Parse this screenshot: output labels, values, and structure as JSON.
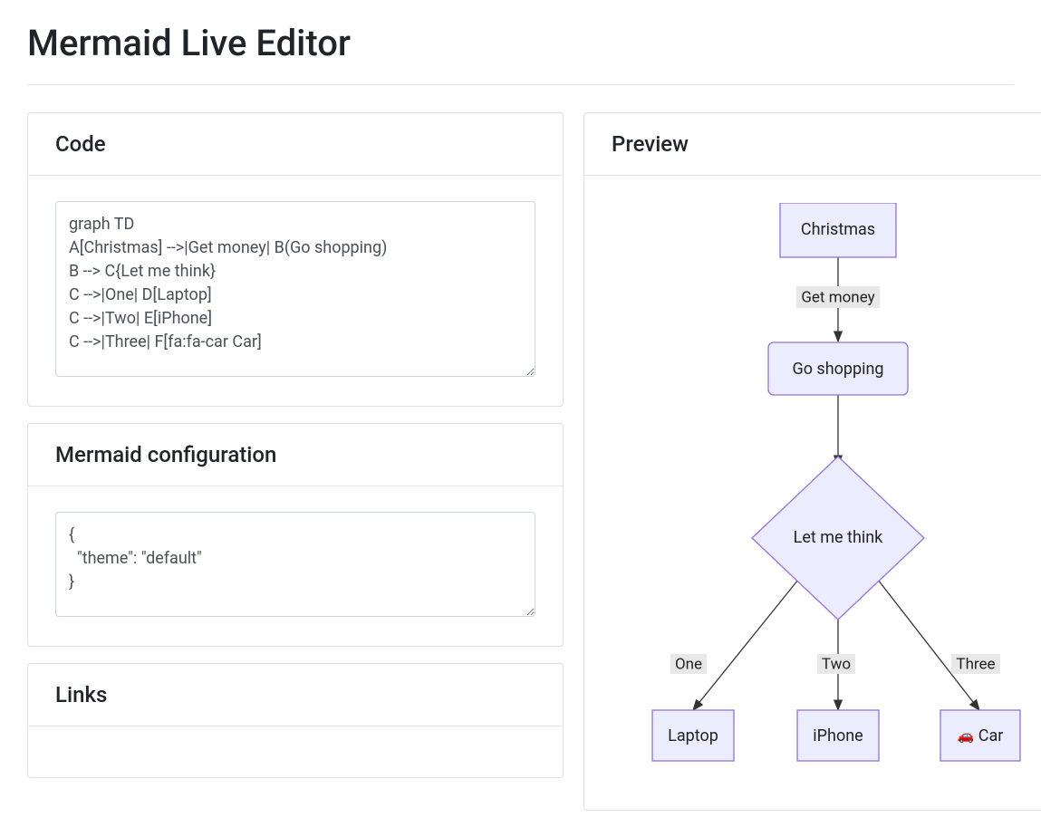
{
  "page_title": "Mermaid Live Editor",
  "panels": {
    "code": {
      "heading": "Code",
      "value": "graph TD\nA[Christmas] -->|Get money| B(Go shopping)\nB --> C{Let me think}\nC -->|One| D[Laptop]\nC -->|Two| E[iPhone]\nC -->|Three| F[fa:fa-car Car]"
    },
    "config": {
      "heading": "Mermaid configuration",
      "value": "{\n  \"theme\": \"default\"\n}"
    },
    "links": {
      "heading": "Links"
    },
    "preview": {
      "heading": "Preview"
    }
  },
  "diagram": {
    "nodes": {
      "A": "Christmas",
      "B": "Go shopping",
      "C": "Let me think",
      "D": "Laptop",
      "E": "iPhone",
      "F_icon": "🚗",
      "F_text": " Car"
    },
    "edge_labels": {
      "AB": "Get money",
      "CD": "One",
      "CE": "Two",
      "CF": "Three"
    }
  }
}
